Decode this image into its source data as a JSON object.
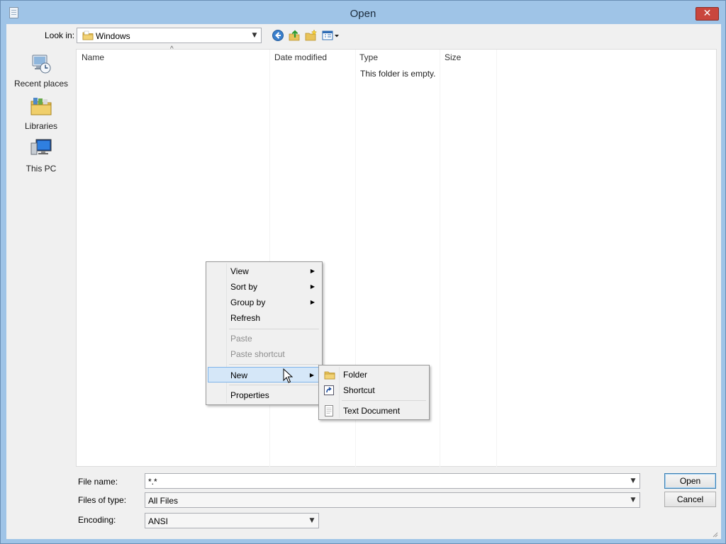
{
  "window": {
    "title": "Open"
  },
  "toolbar": {
    "look_in_label": "Look in:",
    "look_in_value": "Windows",
    "buttons": [
      "back-icon",
      "up-folder-icon",
      "new-folder-icon",
      "view-menu-icon"
    ]
  },
  "places": [
    {
      "label": "Recent places",
      "icon": "recent-places-icon"
    },
    {
      "label": "Libraries",
      "icon": "libraries-icon"
    },
    {
      "label": "This PC",
      "icon": "this-pc-icon"
    }
  ],
  "filelist": {
    "columns": [
      "Name",
      "Date modified",
      "Type",
      "Size"
    ],
    "empty_message": "This folder is empty."
  },
  "form": {
    "file_name_label": "File name:",
    "file_name_value": "*.*",
    "file_type_label": "Files of type:",
    "file_type_value": "All Files",
    "encoding_label": "Encoding:",
    "encoding_value": "ANSI",
    "open_label": "Open",
    "cancel_label": "Cancel"
  },
  "context_menu": {
    "items": [
      {
        "label": "View",
        "submenu": true,
        "enabled": true
      },
      {
        "label": "Sort by",
        "submenu": true,
        "enabled": true
      },
      {
        "label": "Group by",
        "submenu": true,
        "enabled": true
      },
      {
        "label": "Refresh",
        "submenu": false,
        "enabled": true
      },
      {
        "label": "Paste",
        "submenu": false,
        "enabled": false
      },
      {
        "label": "Paste shortcut",
        "submenu": false,
        "enabled": false
      },
      {
        "label": "New",
        "submenu": true,
        "enabled": true,
        "highlighted": true
      },
      {
        "label": "Properties",
        "submenu": false,
        "enabled": true
      }
    ]
  },
  "submenu_new": {
    "items": [
      {
        "label": "Folder",
        "icon": "folder-icon"
      },
      {
        "label": "Shortcut",
        "icon": "shortcut-icon"
      },
      {
        "label": "Text Document",
        "icon": "text-document-icon"
      }
    ]
  },
  "colors": {
    "frame": "#9fc4e7",
    "close_button": "#c9463d",
    "menu_highlight": "#d5e7f8"
  }
}
